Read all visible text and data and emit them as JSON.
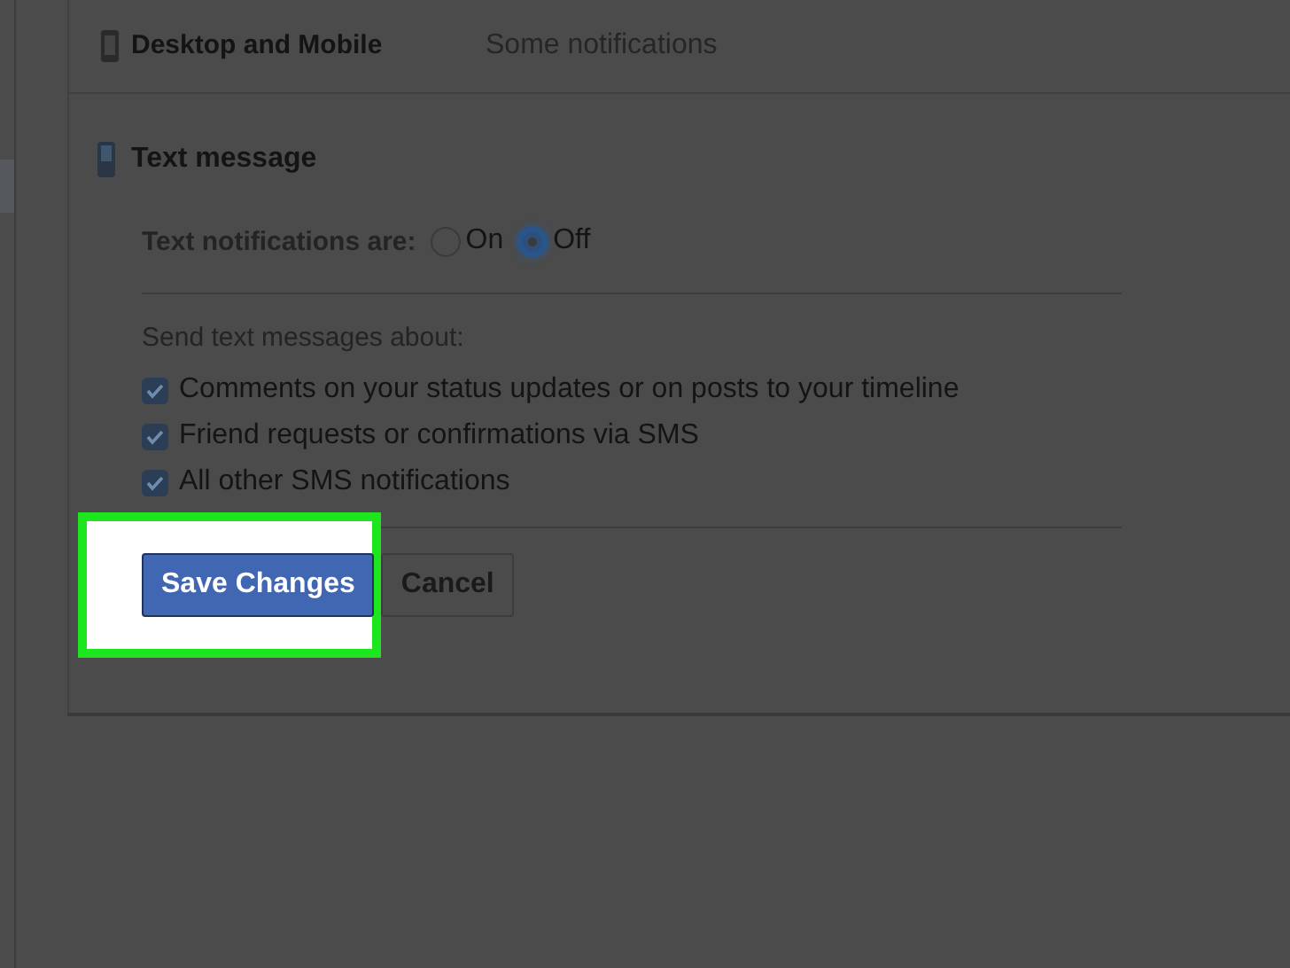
{
  "summary_row": {
    "label": "Desktop and Mobile",
    "value": "Some notifications"
  },
  "section": {
    "title": "Text message"
  },
  "radio_group": {
    "label": "Text notifications are:",
    "options": [
      {
        "label": "On",
        "selected": false
      },
      {
        "label": "Off",
        "selected": true
      }
    ]
  },
  "checklist": {
    "label": "Send text messages about:",
    "items": [
      {
        "label": "Comments on your status updates or on posts to your timeline",
        "checked": true
      },
      {
        "label": "Friend requests or confirmations via SMS",
        "checked": true
      },
      {
        "label": "All other SMS notifications",
        "checked": true
      }
    ]
  },
  "buttons": [
    {
      "label": "Save Changes",
      "kind": "primary",
      "highlighted": true
    },
    {
      "label": "Cancel",
      "kind": "secondary",
      "highlighted": false
    }
  ]
}
